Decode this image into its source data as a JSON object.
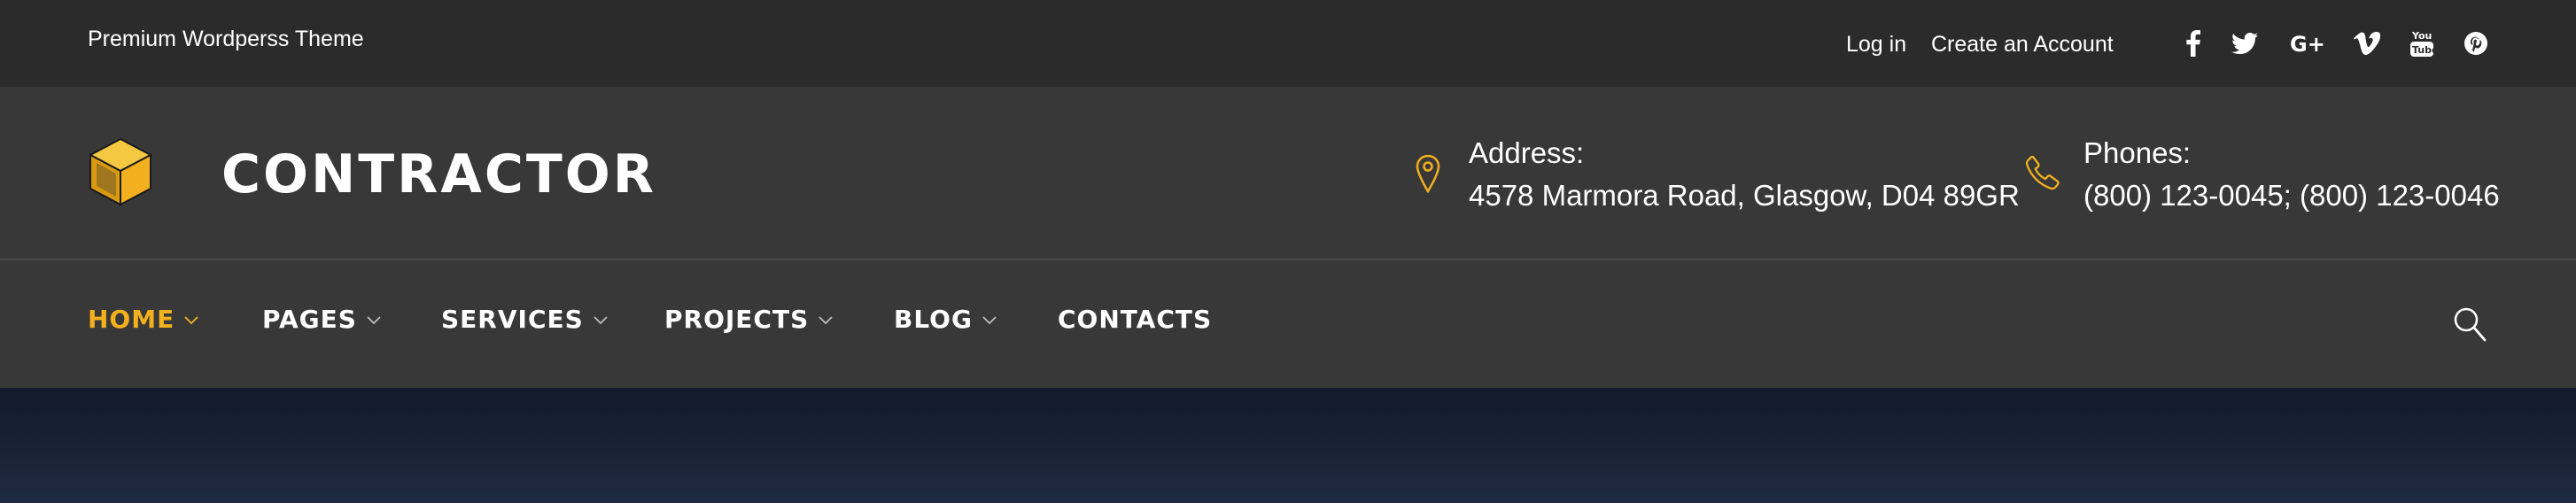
{
  "topbar": {
    "tagline": "Premium Wordperss Theme",
    "login_label": "Log in",
    "create_account_label": "Create an Account",
    "social": [
      "facebook-icon",
      "twitter-icon",
      "google-plus-icon",
      "vimeo-icon",
      "youtube-icon",
      "pinterest-icon"
    ]
  },
  "header": {
    "brand": "CONTRACTOR",
    "address": {
      "label": "Address:",
      "value": "4578 Marmora Road, Glasgow, D04 89GR"
    },
    "phones": {
      "label": "Phones:",
      "value": "(800) 123-0045; (800) 123-0046"
    }
  },
  "nav": {
    "items": [
      {
        "label": "HOME",
        "active": true,
        "has_dropdown": true
      },
      {
        "label": "PAGES",
        "active": false,
        "has_dropdown": true
      },
      {
        "label": "SERVICES",
        "active": false,
        "has_dropdown": true
      },
      {
        "label": "PROJECTS",
        "active": false,
        "has_dropdown": true
      },
      {
        "label": "BLOG",
        "active": false,
        "has_dropdown": true
      },
      {
        "label": "CONTACTS",
        "active": false,
        "has_dropdown": false
      }
    ],
    "search_icon": "search-icon"
  },
  "colors": {
    "accent": "#f2b01e",
    "topbar_bg": "#2b2b2b",
    "header_bg": "#383838",
    "text": "#ffffff"
  }
}
